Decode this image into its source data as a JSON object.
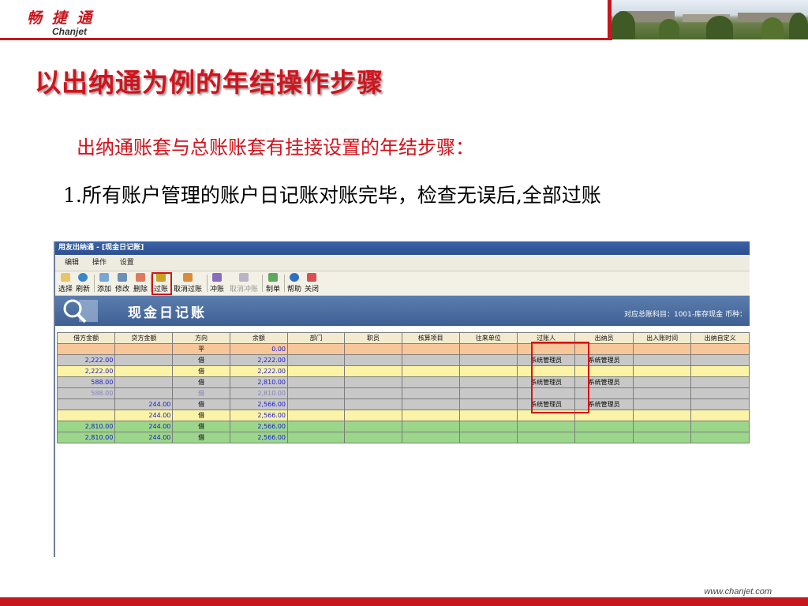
{
  "header": {
    "logo_cn": "畅 捷 通",
    "logo_en": "Chanjet",
    "title": "以出纳通为例的年结操作步骤",
    "subtitle": "出纳通账套与总账账套有挂接设置的年结步骤：",
    "step": "1.所有账户管理的账户日记账对账完毕，检查无误后,全部过账"
  },
  "app": {
    "window_title": "用友出纳通 - [现金日记账]",
    "menu": [
      "编辑",
      "操作",
      "设置"
    ],
    "toolbar": [
      {
        "label": "选择",
        "icon": "select-icon",
        "enabled": true
      },
      {
        "label": "刷新",
        "icon": "refresh-icon",
        "enabled": true
      },
      {
        "label": "添加",
        "icon": "add-icon",
        "enabled": true
      },
      {
        "label": "修改",
        "icon": "edit-icon",
        "enabled": true
      },
      {
        "label": "删除",
        "icon": "delete-icon",
        "enabled": true
      },
      {
        "label": "过账",
        "icon": "post-icon",
        "enabled": true
      },
      {
        "label": "取消过账",
        "icon": "unpost-icon",
        "enabled": true
      },
      {
        "label": "冲账",
        "icon": "reverse-icon",
        "enabled": true
      },
      {
        "label": "取消冲账",
        "icon": "unreverse-icon",
        "enabled": false
      },
      {
        "label": "制单",
        "icon": "voucher-icon",
        "enabled": true
      },
      {
        "label": "帮助",
        "icon": "help-icon",
        "enabled": true
      },
      {
        "label": "关闭",
        "icon": "close-icon",
        "enabled": true
      }
    ],
    "banner_title": "现金日记账",
    "account_info": "对应总账科目：1001-库存现金  币种：",
    "table": {
      "columns": [
        "借方金额",
        "贷方金额",
        "方向",
        "余额",
        "部门",
        "职员",
        "核算项目",
        "往来单位",
        "过账人",
        "出纳员",
        "出入账时间",
        "出纳自定义"
      ],
      "rows": [
        {
          "style": "orange",
          "cells": [
            "",
            "",
            "平",
            "0.00",
            "",
            "",
            "",
            "",
            "",
            "",
            "",
            ""
          ]
        },
        {
          "style": "grey",
          "cells": [
            "2,222.00",
            "",
            "借",
            "2,222.00",
            "",
            "",
            "",
            "",
            "系统管理员",
            "系统管理员",
            "",
            ""
          ]
        },
        {
          "style": "yellow",
          "cells": [
            "2,222.00",
            "",
            "借",
            "2,222.00",
            "",
            "",
            "",
            "",
            "",
            "",
            "",
            ""
          ]
        },
        {
          "style": "grey",
          "cells": [
            "588.00",
            "",
            "借",
            "2,810.00",
            "",
            "",
            "",
            "",
            "系统管理员",
            "系统管理员",
            "",
            ""
          ]
        },
        {
          "style": "grey-faint",
          "cells": [
            "588.00",
            "",
            "借",
            "2,810.00",
            "",
            "",
            "",
            "",
            "",
            "",
            "",
            ""
          ]
        },
        {
          "style": "grey",
          "cells": [
            "",
            "244.00",
            "借",
            "2,566.00",
            "",
            "",
            "",
            "",
            "系统管理员",
            "系统管理员",
            "",
            ""
          ]
        },
        {
          "style": "yellow",
          "cells": [
            "",
            "244.00",
            "借",
            "2,566.00",
            "",
            "",
            "",
            "",
            "",
            "",
            "",
            ""
          ]
        },
        {
          "style": "green",
          "cells": [
            "2,810.00",
            "244.00",
            "借",
            "2,566.00",
            "",
            "",
            "",
            "",
            "",
            "",
            "",
            ""
          ]
        },
        {
          "style": "green",
          "cells": [
            "2,810.00",
            "244.00",
            "借",
            "2,566.00",
            "",
            "",
            "",
            "",
            "",
            "",
            "",
            ""
          ]
        }
      ]
    }
  },
  "footer": {
    "url": "www.chanjet.com"
  },
  "colors": {
    "brand_red": "#c8161d",
    "title_red": "#d1131c",
    "highlight_red": "#d31414"
  }
}
